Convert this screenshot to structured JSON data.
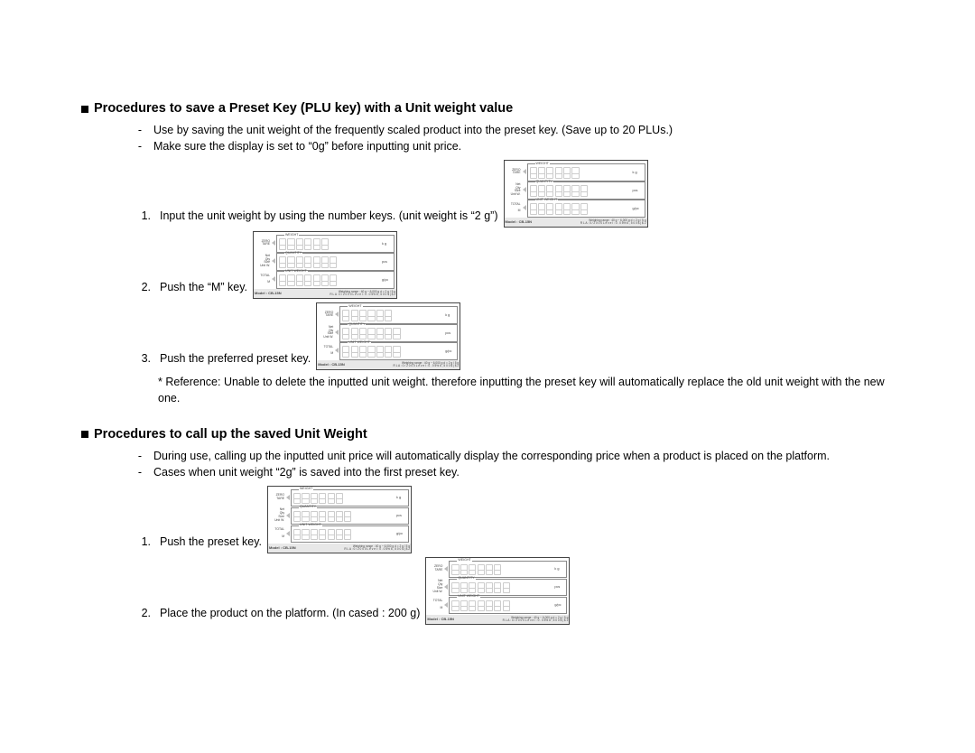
{
  "section1": {
    "title": "Procedures to save a Preset Key (PLU key) with a Unit weight value",
    "bullets": [
      "Use by saving the unit weight of the frequently scaled product into the preset key. (Save up to 20 PLUs.)",
      "Make sure the display is set to “0g” before inputting unit price."
    ],
    "steps": {
      "s1_num": "1.",
      "s1_txt": "Input the unit weight by using the number keys. (unit weight is “2 g”)",
      "s2_num": "2.",
      "s2_txt": "Push the “M” key.",
      "s3_num": "3.",
      "s3_txt": "Push the preferred preset key."
    },
    "reference": "* Reference: Unable to delete the inputted unit weight. therefore inputting the preset key will automatically replace the old unit weight with the new one."
  },
  "section2": {
    "title": "Procedures to call up the saved Unit Weight",
    "bullets": [
      "During use, calling up the inputted unit price will automatically display the corresponding price when a product is placed on the platform.",
      "Cases when unit weight “2g” is saved into the first preset key."
    ],
    "steps": {
      "s1_num": "1.",
      "s1_txt": "Push the preset key.",
      "s2_num": "2.",
      "s2_txt": "Place the product on the platform. (In cased : 200 g)"
    }
  },
  "panel": {
    "row1_left_a": "ZERO",
    "row1_left_b": "TARE",
    "row1_legend": "WEIGHT",
    "row1_unit": "k g",
    "row2_left_a": "Net",
    "row2_left_b": "Qty",
    "row2_left_c": "Size",
    "row2_left_d": "Unit W.",
    "row2_legend": "QUANTITY",
    "row2_unit": "pcs",
    "row3_left_a": "TOTAL",
    "row3_left_b": "",
    "row3_left_c": "M",
    "row3_legend": "UNIT WEIGHT",
    "row3_unit": "g/pc",
    "model": "Model : CB-15N",
    "range1": "Weighing range : 40 g ~ 6,000 g   d = 2 g / 5 g",
    "range2": "R L A :  0 / 2 0 0 0  L e v e l :  0 . 0 5%  6 , 5 0 0 $ | $ 2"
  }
}
